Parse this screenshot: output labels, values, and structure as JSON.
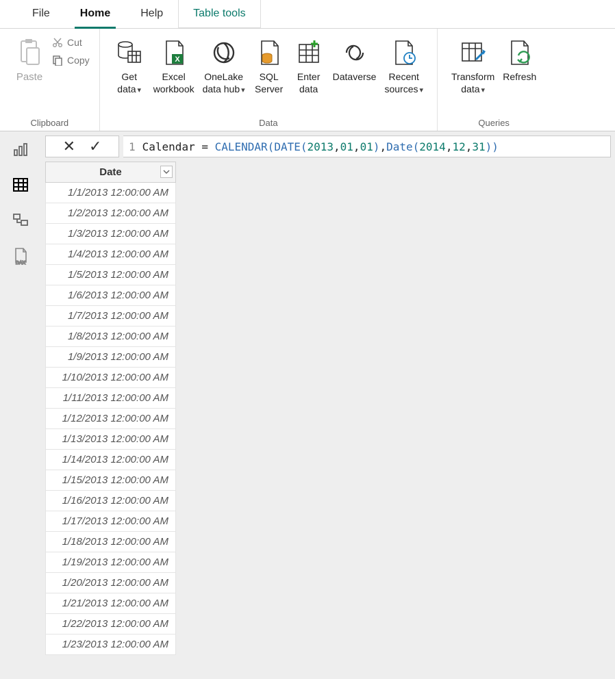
{
  "tabs": {
    "file": "File",
    "home": "Home",
    "help": "Help",
    "table_tools": "Table tools"
  },
  "ribbon": {
    "clipboard": {
      "paste": "Paste",
      "cut": "Cut",
      "copy": "Copy",
      "label": "Clipboard"
    },
    "data": {
      "get_data": "Get\ndata",
      "excel": "Excel\nworkbook",
      "onelake": "OneLake\ndata hub",
      "sql": "SQL\nServer",
      "enter": "Enter\ndata",
      "dataverse": "Dataverse",
      "recent": "Recent\nsources",
      "label": "Data"
    },
    "queries": {
      "transform": "Transform\ndata",
      "refresh": "Refresh",
      "label": "Queries"
    }
  },
  "formula": {
    "line": "1",
    "name": "Calendar",
    "eq": " = ",
    "fn1": "CALENDAR",
    "fn2": "DATE",
    "fn3": "Date",
    "y1": "2013",
    "m1": "01",
    "d1": "01",
    "y2": "2014",
    "m2": "12",
    "d2": "31"
  },
  "column_header": "Date",
  "rows": [
    "1/1/2013 12:00:00 AM",
    "1/2/2013 12:00:00 AM",
    "1/3/2013 12:00:00 AM",
    "1/4/2013 12:00:00 AM",
    "1/5/2013 12:00:00 AM",
    "1/6/2013 12:00:00 AM",
    "1/7/2013 12:00:00 AM",
    "1/8/2013 12:00:00 AM",
    "1/9/2013 12:00:00 AM",
    "1/10/2013 12:00:00 AM",
    "1/11/2013 12:00:00 AM",
    "1/12/2013 12:00:00 AM",
    "1/13/2013 12:00:00 AM",
    "1/14/2013 12:00:00 AM",
    "1/15/2013 12:00:00 AM",
    "1/16/2013 12:00:00 AM",
    "1/17/2013 12:00:00 AM",
    "1/18/2013 12:00:00 AM",
    "1/19/2013 12:00:00 AM",
    "1/20/2013 12:00:00 AM",
    "1/21/2013 12:00:00 AM",
    "1/22/2013 12:00:00 AM",
    "1/23/2013 12:00:00 AM"
  ]
}
